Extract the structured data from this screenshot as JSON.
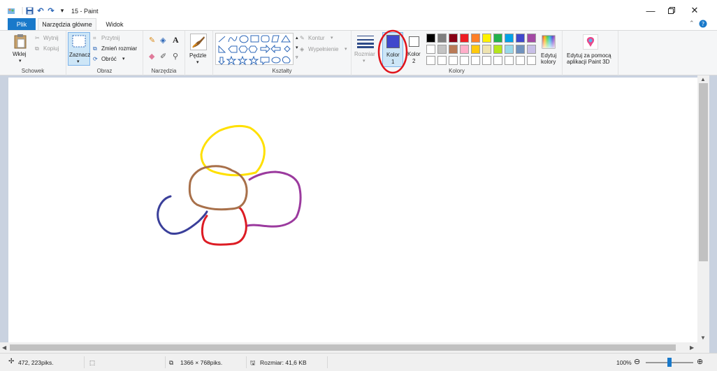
{
  "title": "15 - Paint",
  "tabs": {
    "file": "Plik",
    "home": "Narzędzia główne",
    "view": "Widok"
  },
  "clipboard": {
    "paste": "Wklej",
    "cut": "Wytnij",
    "copy": "Kopiuj",
    "label": "Schowek"
  },
  "image": {
    "select": "Zaznacz",
    "crop": "Przytnij",
    "resize": "Zmień rozmiar",
    "rotate": "Obróć",
    "label": "Obraz"
  },
  "tools": {
    "label": "Narzędzia",
    "brushes": "Pędzle"
  },
  "shapes": {
    "outline": "Kontur",
    "fill": "Wypełnienie",
    "label": "Kształty"
  },
  "colors": {
    "size": "Rozmiar",
    "color1_line1": "Kolor",
    "color1_line2": "1",
    "color2_line1": "Kolor",
    "color2_line2": "2",
    "edit_line1": "Edytuj",
    "edit_line2": "kolory",
    "label": "Kolory",
    "color1_value": "#3f48cc",
    "color2_value": "#ffffff",
    "palette_row1": [
      "#000000",
      "#7f7f7f",
      "#880015",
      "#ed1c24",
      "#ff7f27",
      "#fff200",
      "#22b14c",
      "#00a2e8",
      "#3f48cc",
      "#a349a4"
    ],
    "palette_row2": [
      "#ffffff",
      "#c3c3c3",
      "#b97a57",
      "#ffaec9",
      "#ffc90e",
      "#efe4b0",
      "#b5e61d",
      "#99d9ea",
      "#7092be",
      "#c8bfe7"
    ]
  },
  "paint3d": {
    "line1": "Edytuj za pomocą",
    "line2": "aplikacji Paint 3D"
  },
  "drawing": {
    "strokes": [
      {
        "name": "yellow-loop",
        "color": "#ffe000"
      },
      {
        "name": "brown-loop",
        "color": "#a8704a"
      },
      {
        "name": "purple-loop",
        "color": "#9b3a9e"
      },
      {
        "name": "red-loop",
        "color": "#dd1c24"
      },
      {
        "name": "blue-curve",
        "color": "#3a3f9a"
      }
    ]
  },
  "status": {
    "cursor_pos": "472, 223piks.",
    "image_size": "1366 × 768piks.",
    "file_size": "Rozmiar: 41,6 KB",
    "zoom": "100%"
  },
  "annotation_color": "#e0141c"
}
